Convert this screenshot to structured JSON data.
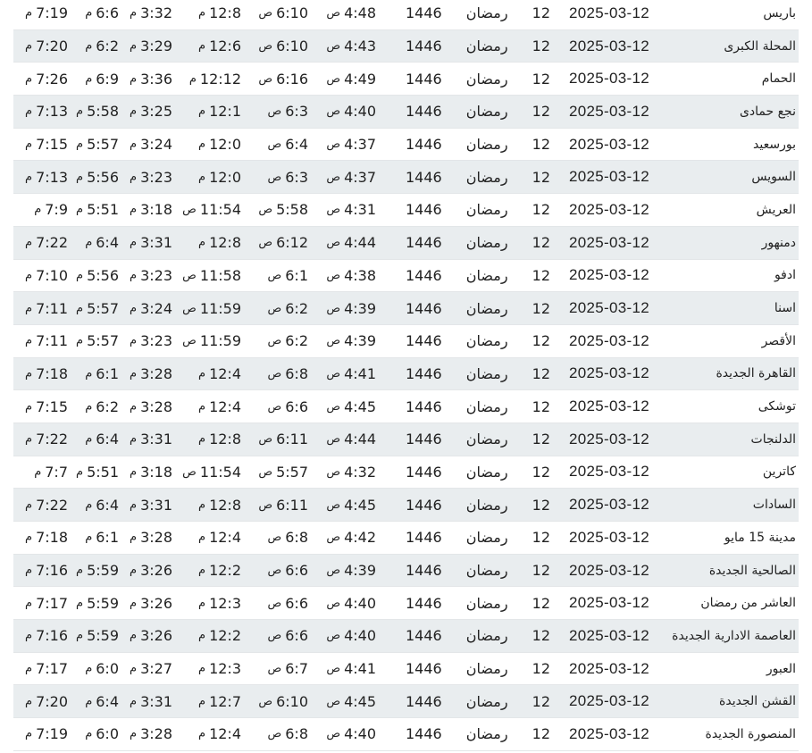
{
  "hijri_month": "رمضان",
  "rows": [
    {
      "city": "باريس",
      "date": "2025-03-12",
      "hijri_day": "12",
      "hijri_year": "1446",
      "fajr": "4:48",
      "fajr_s": "ص",
      "sunrise": "6:10",
      "sunrise_s": "ص",
      "dhuhr": "12:8",
      "dhuhr_s": "م",
      "asr": "3:32",
      "asr_s": "م",
      "maghrib": "6:6",
      "maghrib_s": "م",
      "isha": "7:19",
      "isha_s": "م"
    },
    {
      "city": "المحلة الكبرى",
      "date": "2025-03-12",
      "hijri_day": "12",
      "hijri_year": "1446",
      "fajr": "4:43",
      "fajr_s": "ص",
      "sunrise": "6:10",
      "sunrise_s": "ص",
      "dhuhr": "12:6",
      "dhuhr_s": "م",
      "asr": "3:29",
      "asr_s": "م",
      "maghrib": "6:2",
      "maghrib_s": "م",
      "isha": "7:20",
      "isha_s": "م"
    },
    {
      "city": "الحمام",
      "date": "2025-03-12",
      "hijri_day": "12",
      "hijri_year": "1446",
      "fajr": "4:49",
      "fajr_s": "ص",
      "sunrise": "6:16",
      "sunrise_s": "ص",
      "dhuhr": "12:12",
      "dhuhr_s": "م",
      "asr": "3:36",
      "asr_s": "م",
      "maghrib": "6:9",
      "maghrib_s": "م",
      "isha": "7:26",
      "isha_s": "م"
    },
    {
      "city": "نجع حمادى",
      "date": "2025-03-12",
      "hijri_day": "12",
      "hijri_year": "1446",
      "fajr": "4:40",
      "fajr_s": "ص",
      "sunrise": "6:3",
      "sunrise_s": "ص",
      "dhuhr": "12:1",
      "dhuhr_s": "م",
      "asr": "3:25",
      "asr_s": "م",
      "maghrib": "5:58",
      "maghrib_s": "م",
      "isha": "7:13",
      "isha_s": "م"
    },
    {
      "city": "بورسعيد",
      "date": "2025-03-12",
      "hijri_day": "12",
      "hijri_year": "1446",
      "fajr": "4:37",
      "fajr_s": "ص",
      "sunrise": "6:4",
      "sunrise_s": "ص",
      "dhuhr": "12:0",
      "dhuhr_s": "م",
      "asr": "3:24",
      "asr_s": "م",
      "maghrib": "5:57",
      "maghrib_s": "م",
      "isha": "7:15",
      "isha_s": "م"
    },
    {
      "city": "السويس",
      "date": "2025-03-12",
      "hijri_day": "12",
      "hijri_year": "1446",
      "fajr": "4:37",
      "fajr_s": "ص",
      "sunrise": "6:3",
      "sunrise_s": "ص",
      "dhuhr": "12:0",
      "dhuhr_s": "م",
      "asr": "3:23",
      "asr_s": "م",
      "maghrib": "5:56",
      "maghrib_s": "م",
      "isha": "7:13",
      "isha_s": "م"
    },
    {
      "city": "العريش",
      "date": "2025-03-12",
      "hijri_day": "12",
      "hijri_year": "1446",
      "fajr": "4:31",
      "fajr_s": "ص",
      "sunrise": "5:58",
      "sunrise_s": "ص",
      "dhuhr": "11:54",
      "dhuhr_s": "ص",
      "asr": "3:18",
      "asr_s": "م",
      "maghrib": "5:51",
      "maghrib_s": "م",
      "isha": "7:9",
      "isha_s": "م"
    },
    {
      "city": "دمنهور",
      "date": "2025-03-12",
      "hijri_day": "12",
      "hijri_year": "1446",
      "fajr": "4:44",
      "fajr_s": "ص",
      "sunrise": "6:12",
      "sunrise_s": "ص",
      "dhuhr": "12:8",
      "dhuhr_s": "م",
      "asr": "3:31",
      "asr_s": "م",
      "maghrib": "6:4",
      "maghrib_s": "م",
      "isha": "7:22",
      "isha_s": "م"
    },
    {
      "city": "ادفو",
      "date": "2025-03-12",
      "hijri_day": "12",
      "hijri_year": "1446",
      "fajr": "4:38",
      "fajr_s": "ص",
      "sunrise": "6:1",
      "sunrise_s": "ص",
      "dhuhr": "11:58",
      "dhuhr_s": "ص",
      "asr": "3:23",
      "asr_s": "م",
      "maghrib": "5:56",
      "maghrib_s": "م",
      "isha": "7:10",
      "isha_s": "م"
    },
    {
      "city": "اسنا",
      "date": "2025-03-12",
      "hijri_day": "12",
      "hijri_year": "1446",
      "fajr": "4:39",
      "fajr_s": "ص",
      "sunrise": "6:2",
      "sunrise_s": "ص",
      "dhuhr": "11:59",
      "dhuhr_s": "ص",
      "asr": "3:24",
      "asr_s": "م",
      "maghrib": "5:57",
      "maghrib_s": "م",
      "isha": "7:11",
      "isha_s": "م"
    },
    {
      "city": "الأقصر",
      "date": "2025-03-12",
      "hijri_day": "12",
      "hijri_year": "1446",
      "fajr": "4:39",
      "fajr_s": "ص",
      "sunrise": "6:2",
      "sunrise_s": "ص",
      "dhuhr": "11:59",
      "dhuhr_s": "ص",
      "asr": "3:23",
      "asr_s": "م",
      "maghrib": "5:57",
      "maghrib_s": "م",
      "isha": "7:11",
      "isha_s": "م"
    },
    {
      "city": "القاهرة الجديدة",
      "date": "2025-03-12",
      "hijri_day": "12",
      "hijri_year": "1446",
      "fajr": "4:41",
      "fajr_s": "ص",
      "sunrise": "6:8",
      "sunrise_s": "ص",
      "dhuhr": "12:4",
      "dhuhr_s": "م",
      "asr": "3:28",
      "asr_s": "م",
      "maghrib": "6:1",
      "maghrib_s": "م",
      "isha": "7:18",
      "isha_s": "م"
    },
    {
      "city": "توشكى",
      "date": "2025-03-12",
      "hijri_day": "12",
      "hijri_year": "1446",
      "fajr": "4:45",
      "fajr_s": "ص",
      "sunrise": "6:6",
      "sunrise_s": "ص",
      "dhuhr": "12:4",
      "dhuhr_s": "م",
      "asr": "3:28",
      "asr_s": "م",
      "maghrib": "6:2",
      "maghrib_s": "م",
      "isha": "7:15",
      "isha_s": "م"
    },
    {
      "city": "الدلنجات",
      "date": "2025-03-12",
      "hijri_day": "12",
      "hijri_year": "1446",
      "fajr": "4:44",
      "fajr_s": "ص",
      "sunrise": "6:11",
      "sunrise_s": "ص",
      "dhuhr": "12:8",
      "dhuhr_s": "م",
      "asr": "3:31",
      "asr_s": "م",
      "maghrib": "6:4",
      "maghrib_s": "م",
      "isha": "7:22",
      "isha_s": "م"
    },
    {
      "city": "كاترين",
      "date": "2025-03-12",
      "hijri_day": "12",
      "hijri_year": "1446",
      "fajr": "4:32",
      "fajr_s": "ص",
      "sunrise": "5:57",
      "sunrise_s": "ص",
      "dhuhr": "11:54",
      "dhuhr_s": "ص",
      "asr": "3:18",
      "asr_s": "م",
      "maghrib": "5:51",
      "maghrib_s": "م",
      "isha": "7:7",
      "isha_s": "م"
    },
    {
      "city": "السادات",
      "date": "2025-03-12",
      "hijri_day": "12",
      "hijri_year": "1446",
      "fajr": "4:45",
      "fajr_s": "ص",
      "sunrise": "6:11",
      "sunrise_s": "ص",
      "dhuhr": "12:8",
      "dhuhr_s": "م",
      "asr": "3:31",
      "asr_s": "م",
      "maghrib": "6:4",
      "maghrib_s": "م",
      "isha": "7:22",
      "isha_s": "م"
    },
    {
      "city": "مدينة 15 مايو",
      "date": "2025-03-12",
      "hijri_day": "12",
      "hijri_year": "1446",
      "fajr": "4:42",
      "fajr_s": "ص",
      "sunrise": "6:8",
      "sunrise_s": "ص",
      "dhuhr": "12:4",
      "dhuhr_s": "م",
      "asr": "3:28",
      "asr_s": "م",
      "maghrib": "6:1",
      "maghrib_s": "م",
      "isha": "7:18",
      "isha_s": "م"
    },
    {
      "city": "الصالحية الجديدة",
      "date": "2025-03-12",
      "hijri_day": "12",
      "hijri_year": "1446",
      "fajr": "4:39",
      "fajr_s": "ص",
      "sunrise": "6:6",
      "sunrise_s": "ص",
      "dhuhr": "12:2",
      "dhuhr_s": "م",
      "asr": "3:26",
      "asr_s": "م",
      "maghrib": "5:59",
      "maghrib_s": "م",
      "isha": "7:16",
      "isha_s": "م"
    },
    {
      "city": "العاشر من رمضان",
      "date": "2025-03-12",
      "hijri_day": "12",
      "hijri_year": "1446",
      "fajr": "4:40",
      "fajr_s": "ص",
      "sunrise": "6:6",
      "sunrise_s": "ص",
      "dhuhr": "12:3",
      "dhuhr_s": "م",
      "asr": "3:26",
      "asr_s": "م",
      "maghrib": "5:59",
      "maghrib_s": "م",
      "isha": "7:17",
      "isha_s": "م"
    },
    {
      "city": "العاصمة الادارية الجديدة",
      "date": "2025-03-12",
      "hijri_day": "12",
      "hijri_year": "1446",
      "fajr": "4:40",
      "fajr_s": "ص",
      "sunrise": "6:6",
      "sunrise_s": "ص",
      "dhuhr": "12:2",
      "dhuhr_s": "م",
      "asr": "3:26",
      "asr_s": "م",
      "maghrib": "5:59",
      "maghrib_s": "م",
      "isha": "7:16",
      "isha_s": "م"
    },
    {
      "city": "العبور",
      "date": "2025-03-12",
      "hijri_day": "12",
      "hijri_year": "1446",
      "fajr": "4:41",
      "fajr_s": "ص",
      "sunrise": "6:7",
      "sunrise_s": "ص",
      "dhuhr": "12:3",
      "dhuhr_s": "م",
      "asr": "3:27",
      "asr_s": "م",
      "maghrib": "6:0",
      "maghrib_s": "م",
      "isha": "7:17",
      "isha_s": "م"
    },
    {
      "city": "القشن الجديدة",
      "date": "2025-03-12",
      "hijri_day": "12",
      "hijri_year": "1446",
      "fajr": "4:45",
      "fajr_s": "ص",
      "sunrise": "6:10",
      "sunrise_s": "ص",
      "dhuhr": "12:7",
      "dhuhr_s": "م",
      "asr": "3:31",
      "asr_s": "م",
      "maghrib": "6:4",
      "maghrib_s": "م",
      "isha": "7:20",
      "isha_s": "م"
    },
    {
      "city": "المنصورة الجديدة",
      "date": "2025-03-12",
      "hijri_day": "12",
      "hijri_year": "1446",
      "fajr": "4:40",
      "fajr_s": "ص",
      "sunrise": "6:8",
      "sunrise_s": "ص",
      "dhuhr": "12:4",
      "dhuhr_s": "م",
      "asr": "3:28",
      "asr_s": "م",
      "maghrib": "6:0",
      "maghrib_s": "م",
      "isha": "7:19",
      "isha_s": "م"
    }
  ]
}
